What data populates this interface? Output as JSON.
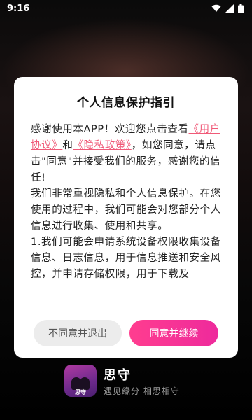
{
  "status_bar": {
    "time": "9:16",
    "icons": [
      "wifi-icon",
      "signal-icon",
      "battery-icon"
    ]
  },
  "dialog": {
    "title": "个人信息保护指引",
    "intro_before": "感谢使用本APP！欢迎您点击查看",
    "link_user_agreement": "《用户协议》",
    "and": "和",
    "link_privacy_policy": "《隐私政策》",
    "intro_after": "，如您同意，请点击\"同意\"并接受我们的服务，感谢您的信任!",
    "para2": "我们非常重视隐私和个人信息保护。在您使用的过程中，我们可能会对您部分个人信息进行收集、使用和共享。",
    "para3": "1.我们可能会申请系统设备权限收集设备信息、日志信息，用于信息推送和安全风控，并申请存储权限，用于下载及",
    "decline_label": "不同意并退出",
    "agree_label": "同意并继续"
  },
  "brand": {
    "logo_caption": "思守",
    "name": "思守",
    "slogan": "遇见缘分 相思相守"
  },
  "colors": {
    "accent_pink": "#ff3d8f",
    "link": "#f05a78"
  }
}
